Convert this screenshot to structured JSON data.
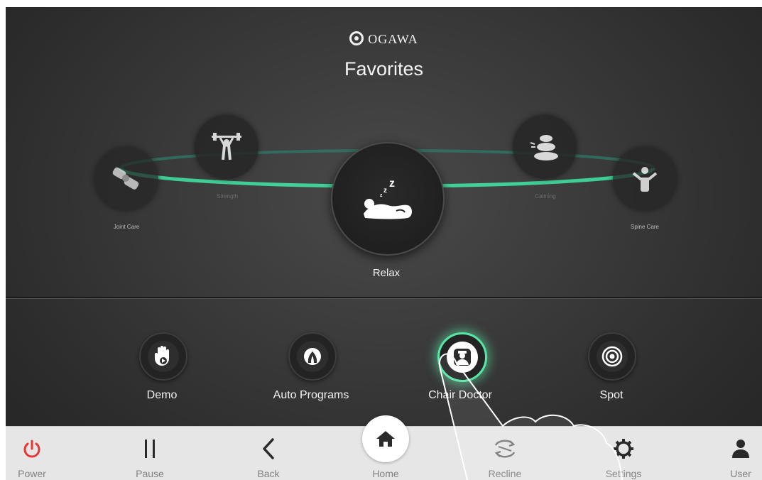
{
  "brand": {
    "logo_text": "OGAWA"
  },
  "page": {
    "title": "Favorites"
  },
  "favorites": {
    "center": {
      "label": "Relax",
      "icon": "relax-icon"
    },
    "items": [
      {
        "label": "Joint Care",
        "icon": "joint-care-icon"
      },
      {
        "label": "Strength",
        "icon": "strength-icon"
      },
      {
        "label": "Calming",
        "icon": "stones-icon"
      },
      {
        "label": "Spine Care",
        "icon": "spine-care-icon"
      }
    ]
  },
  "quick_actions": [
    {
      "label": "Demo",
      "icon": "hand-play-icon"
    },
    {
      "label": "Auto Programs",
      "icon": "auto-programs-icon"
    },
    {
      "label": "Chair Doctor",
      "icon": "doctor-icon",
      "active": true
    },
    {
      "label": "Spot",
      "icon": "target-icon"
    }
  ],
  "nav": {
    "power": "Power",
    "pause": "Pause",
    "back": "Back",
    "home": "Home",
    "recline": "Recline",
    "settings": "Settings",
    "user": "User"
  },
  "colors": {
    "accent": "#58e6a6",
    "power": "#e53935",
    "background": "#333333",
    "navbar": "#e6e6e6"
  }
}
